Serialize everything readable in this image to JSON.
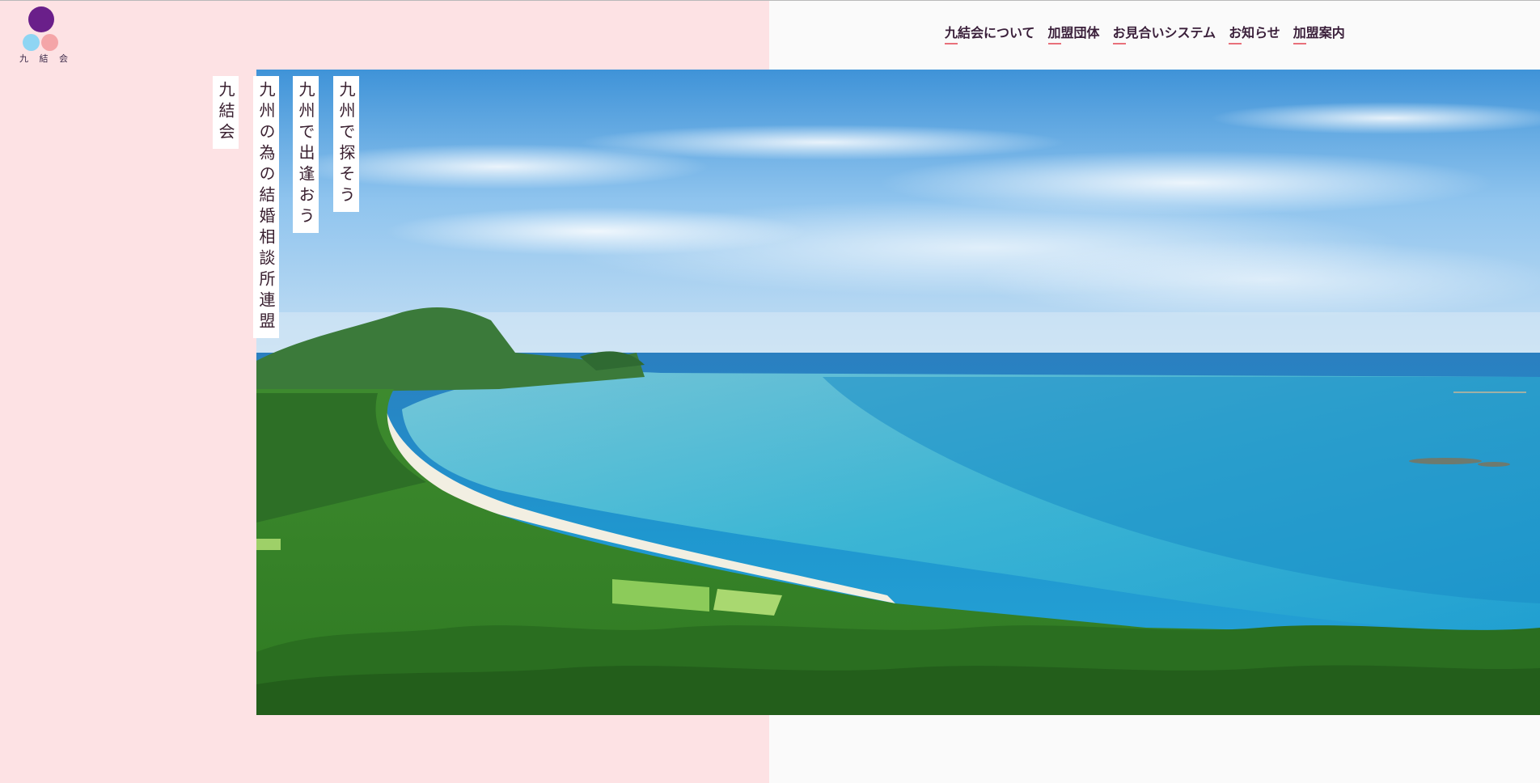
{
  "logo": {
    "text": "九 結 会"
  },
  "nav": {
    "items": [
      {
        "label": "九結会について"
      },
      {
        "label": "加盟団体"
      },
      {
        "label": "お見合いシステム"
      },
      {
        "label": "お知らせ"
      },
      {
        "label": "加盟案内"
      }
    ]
  },
  "taglines": {
    "brand": "九結会",
    "federation": "九州の為の結婚相談所連盟",
    "meet": "九州で出逢おう",
    "search": "九州で探そう"
  },
  "hero": {
    "slide_count": 3,
    "active_slide": 1
  },
  "colors": {
    "pink_panel": "#fde2e4",
    "page_bg": "#fafafa",
    "logo_purple": "#6a1f8a",
    "logo_blue": "#8fd5f3",
    "logo_pink": "#f4a5a8",
    "nav_underline": "#e8707a",
    "text_dark": "#3a1f3a"
  }
}
